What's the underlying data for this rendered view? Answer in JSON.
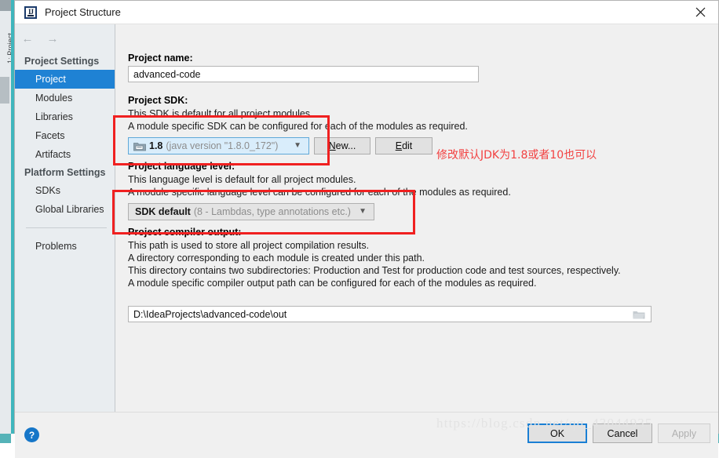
{
  "window": {
    "title": "Project Structure",
    "app_icon": "intellij-idea-icon",
    "close_icon": "close-icon"
  },
  "ide_background": {
    "tool_window_tab": "1: Project"
  },
  "nav": {
    "back_icon": "arrow-left-icon",
    "forward_icon": "arrow-right-icon",
    "groups": [
      {
        "label": "Project Settings",
        "items": [
          {
            "label": "Project",
            "selected": true
          },
          {
            "label": "Modules",
            "selected": false
          },
          {
            "label": "Libraries",
            "selected": false
          },
          {
            "label": "Facets",
            "selected": false
          },
          {
            "label": "Artifacts",
            "selected": false
          }
        ]
      },
      {
        "label": "Platform Settings",
        "items": [
          {
            "label": "SDKs",
            "selected": false
          },
          {
            "label": "Global Libraries",
            "selected": false
          }
        ]
      }
    ],
    "problems": "Problems"
  },
  "main": {
    "project_name": {
      "label": "Project name:",
      "value": "advanced-code"
    },
    "project_sdk": {
      "label": "Project SDK:",
      "desc1": "This SDK is default for all project modules.",
      "desc2": "A module specific SDK can be configured for each of the modules as required.",
      "combo_icon": "jdk-folder-icon",
      "combo_main": "1.8",
      "combo_sub": "(java version \"1.8.0_172\")",
      "chevron_icon": "chevron-down-icon",
      "new_button": {
        "prefix": "",
        "mnemonic": "N",
        "suffix": "ew..."
      },
      "edit_button": {
        "prefix": "",
        "mnemonic": "E",
        "suffix": "dit"
      }
    },
    "language_level": {
      "label": "Project language level:",
      "desc1": "This language level is default for all project modules.",
      "desc2": "A module specific language level can be configured for each of the modules as required.",
      "combo_main": "SDK default",
      "combo_sub": "(8 - Lambdas, type annotations etc.)",
      "chevron_icon": "chevron-down-icon"
    },
    "compiler_output": {
      "label": "Project compiler output:",
      "desc1": "This path is used to store all project compilation results.",
      "desc2": "A directory corresponding to each module is created under this path.",
      "desc3": "This directory contains two subdirectories: Production and Test for production code and test sources, respectively.",
      "desc4": "A module specific compiler output path can be configured for each of the modules as required.",
      "value": "D:\\IdeaProjects\\advanced-code\\out",
      "browse_icon": "folder-browse-icon"
    }
  },
  "annotations": {
    "note_text": "修改默认JDK为1.8或者10也可以",
    "color": "#f24141"
  },
  "footer": {
    "help_icon": "help-icon",
    "ok_label": "OK",
    "cancel_label": "Cancel",
    "apply_label": "Apply"
  },
  "watermark": {
    "text": "https://blog.csdn.net/qq_43044935"
  }
}
